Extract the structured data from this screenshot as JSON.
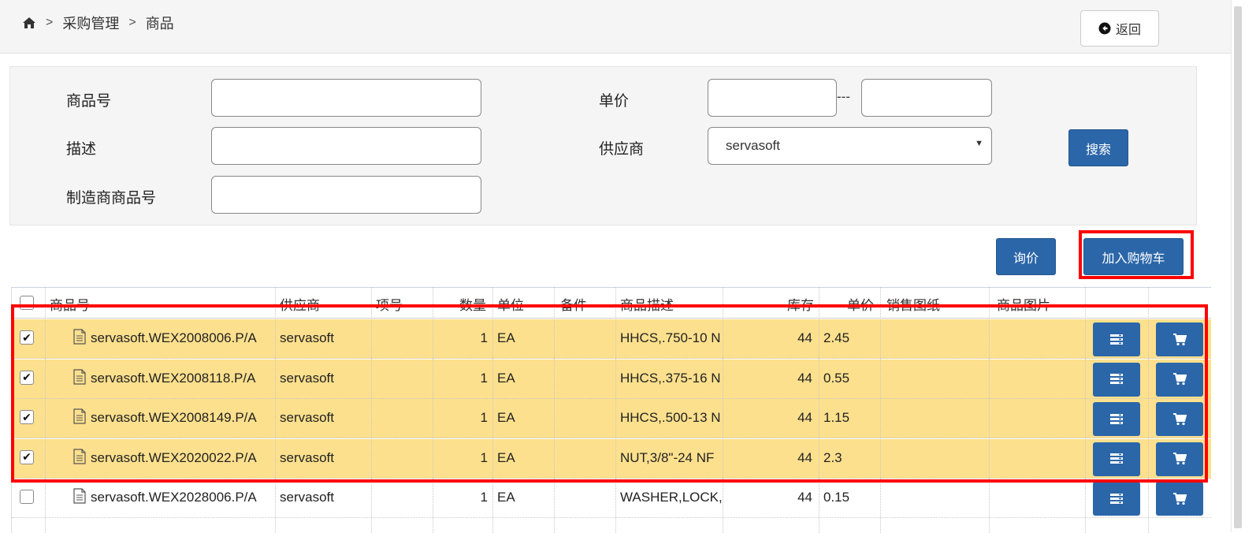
{
  "breadcrumb": {
    "home_icon": "home-icon",
    "items": [
      "采购管理",
      "商品"
    ],
    "separator": ">"
  },
  "header": {
    "back_label": "返回",
    "back_icon": "circle-arrow-left-icon"
  },
  "search": {
    "item_no_label": "商品号",
    "item_no_value": "",
    "desc_label": "描述",
    "desc_value": "",
    "mfr_no_label": "制造商商品号",
    "mfr_no_value": "",
    "price_label": "单价",
    "price_min": "",
    "price_sep": "---",
    "price_max": "",
    "supplier_label": "供应商",
    "supplier_value": "servasoft",
    "search_button": "搜索"
  },
  "actions": {
    "inquiry_button": "询价",
    "add_cart_button": "加入购物车"
  },
  "table": {
    "columns": [
      "商品号",
      "供应商",
      "项号",
      "数量",
      "单位",
      "备件",
      "商品描述",
      "库存",
      "单价",
      "销售图纸",
      "商品图片"
    ],
    "rows": [
      {
        "checked": true,
        "item_no": "servasoft.WEX2008006.P/A",
        "supplier": "servasoft",
        "line_no": "",
        "qty": "1",
        "unit": "EA",
        "spare": "",
        "desc": "HHCS,.750-10 N",
        "stock": "44",
        "price": "2.45",
        "drawing": "",
        "image": ""
      },
      {
        "checked": true,
        "item_no": "servasoft.WEX2008118.P/A",
        "supplier": "servasoft",
        "line_no": "",
        "qty": "1",
        "unit": "EA",
        "spare": "",
        "desc": "HHCS,.375-16 N",
        "stock": "44",
        "price": "0.55",
        "drawing": "",
        "image": ""
      },
      {
        "checked": true,
        "item_no": "servasoft.WEX2008149.P/A",
        "supplier": "servasoft",
        "line_no": "",
        "qty": "1",
        "unit": "EA",
        "spare": "",
        "desc": "HHCS,.500-13 N",
        "stock": "44",
        "price": "1.15",
        "drawing": "",
        "image": ""
      },
      {
        "checked": true,
        "item_no": "servasoft.WEX2020022.P/A",
        "supplier": "servasoft",
        "line_no": "",
        "qty": "1",
        "unit": "EA",
        "spare": "",
        "desc": "NUT,3/8\"-24 NF",
        "stock": "44",
        "price": "2.3",
        "drawing": "",
        "image": ""
      },
      {
        "checked": false,
        "item_no": "servasoft.WEX2028006.P/A",
        "supplier": "servasoft",
        "line_no": "",
        "qty": "1",
        "unit": "EA",
        "spare": "",
        "desc": "WASHER,LOCK,S",
        "stock": "44",
        "price": "0.15",
        "drawing": "",
        "image": ""
      }
    ],
    "row_icons": {
      "detail": "list-icon",
      "cart": "cart-icon",
      "file": "document-icon"
    }
  },
  "colors": {
    "accent": "#2b66a8",
    "selected_row": "#fde08d",
    "highlight": "#ff0000"
  }
}
